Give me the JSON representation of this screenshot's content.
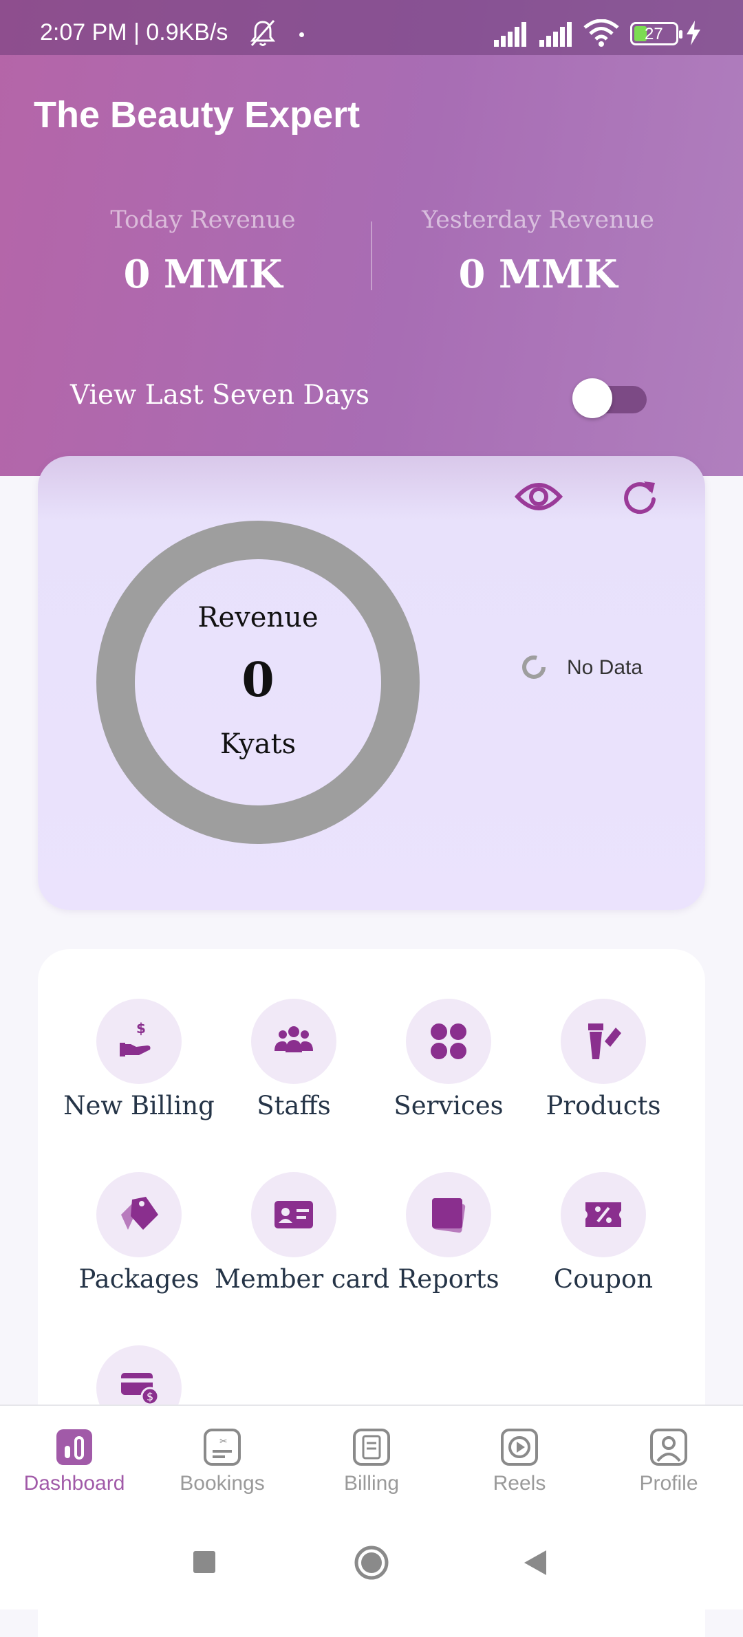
{
  "status_bar": {
    "time": "2:07 PM | 0.9KB/s",
    "battery": "27"
  },
  "app": {
    "title": "The Beauty Expert"
  },
  "revenue": {
    "today_label": "Today Revenue",
    "today_value": "0 MMK",
    "yesterday_label": "Yesterday Revenue",
    "yesterday_value": "0 MMK"
  },
  "seven_days": {
    "label": "View Last Seven Days",
    "enabled": false
  },
  "chart_card": {
    "center_label": "Revenue",
    "center_value": "0",
    "center_unit": "Kyats",
    "legend_text": "No Data"
  },
  "chart_data": {
    "type": "pie",
    "title": "Revenue",
    "categories": [],
    "values": [],
    "total": 0,
    "unit": "Kyats",
    "empty_text": "No Data"
  },
  "menu": {
    "items": [
      {
        "label": "New Billing",
        "icon": "hand-money-icon"
      },
      {
        "label": "Staffs",
        "icon": "people-icon"
      },
      {
        "label": "Services",
        "icon": "grid-icon"
      },
      {
        "label": "Products",
        "icon": "cosmetics-icon"
      },
      {
        "label": "Packages",
        "icon": "tags-icon"
      },
      {
        "label": "Member card",
        "icon": "id-card-icon"
      },
      {
        "label": "Reports",
        "icon": "stack-icon"
      },
      {
        "label": "Coupon",
        "icon": "coupon-icon"
      },
      {
        "label": "",
        "icon": "card-payment-icon"
      }
    ]
  },
  "bottom_nav": {
    "items": [
      {
        "label": "Dashboard",
        "active": true
      },
      {
        "label": "Bookings",
        "active": false
      },
      {
        "label": "Billing",
        "active": false
      },
      {
        "label": "Reels",
        "active": false
      },
      {
        "label": "Profile",
        "active": false
      }
    ]
  },
  "colors": {
    "accent": "#a15aa8",
    "header_gradient_start": "#b565a8",
    "header_gradient_end": "#b07fbe",
    "icon_purple": "#8a2f8e",
    "donut_gray": "#9e9e9e"
  }
}
